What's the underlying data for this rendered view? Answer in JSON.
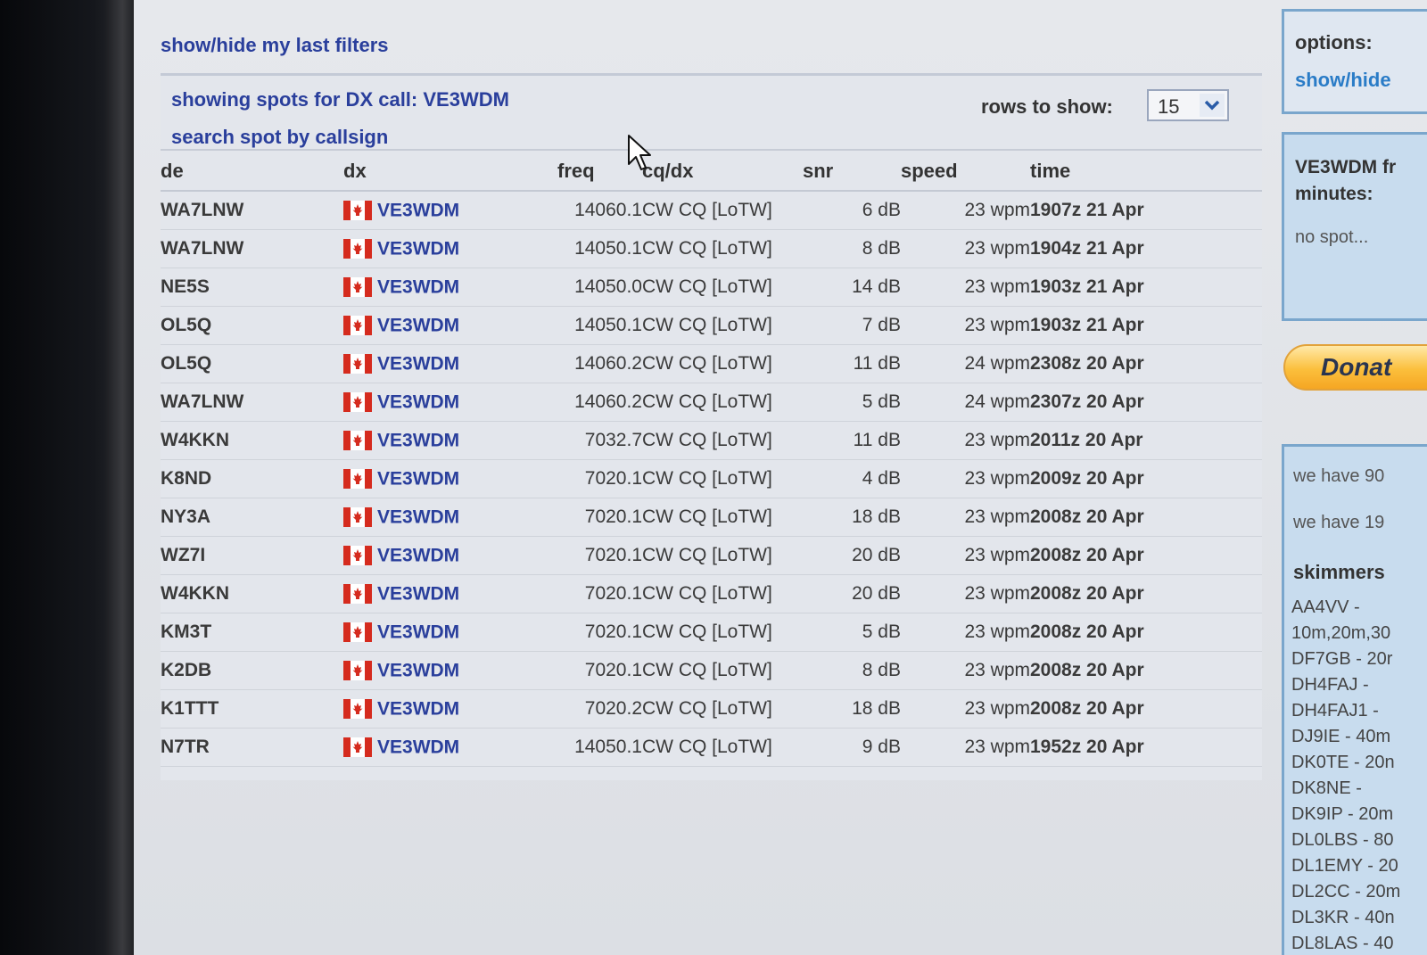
{
  "filters_link": "show/hide my last filters",
  "header": {
    "showing": "showing spots for DX call: VE3WDM",
    "search_link": "search spot by callsign",
    "rows_label": "rows to show:",
    "rows_value": "15"
  },
  "columns": [
    "de",
    "dx",
    "freq",
    "cq/dx",
    "snr",
    "speed",
    "time"
  ],
  "rows": [
    {
      "de": "WA7LNW",
      "dx": "VE3WDM",
      "freq": "14060.1",
      "cq": "CW CQ [LoTW]",
      "snr": "6 dB",
      "speed": "23 wpm",
      "time": "1907z 21 Apr"
    },
    {
      "de": "WA7LNW",
      "dx": "VE3WDM",
      "freq": "14050.1",
      "cq": "CW CQ [LoTW]",
      "snr": "8 dB",
      "speed": "23 wpm",
      "time": "1904z 21 Apr"
    },
    {
      "de": "NE5S",
      "dx": "VE3WDM",
      "freq": "14050.0",
      "cq": "CW CQ [LoTW]",
      "snr": "14 dB",
      "speed": "23 wpm",
      "time": "1903z 21 Apr"
    },
    {
      "de": "OL5Q",
      "dx": "VE3WDM",
      "freq": "14050.1",
      "cq": "CW CQ [LoTW]",
      "snr": "7 dB",
      "speed": "23 wpm",
      "time": "1903z 21 Apr"
    },
    {
      "de": "OL5Q",
      "dx": "VE3WDM",
      "freq": "14060.2",
      "cq": "CW CQ [LoTW]",
      "snr": "11 dB",
      "speed": "24 wpm",
      "time": "2308z 20 Apr"
    },
    {
      "de": "WA7LNW",
      "dx": "VE3WDM",
      "freq": "14060.2",
      "cq": "CW CQ [LoTW]",
      "snr": "5 dB",
      "speed": "24 wpm",
      "time": "2307z 20 Apr"
    },
    {
      "de": "W4KKN",
      "dx": "VE3WDM",
      "freq": "7032.7",
      "cq": "CW CQ [LoTW]",
      "snr": "11 dB",
      "speed": "23 wpm",
      "time": "2011z 20 Apr"
    },
    {
      "de": "K8ND",
      "dx": "VE3WDM",
      "freq": "7020.1",
      "cq": "CW CQ [LoTW]",
      "snr": "4 dB",
      "speed": "23 wpm",
      "time": "2009z 20 Apr"
    },
    {
      "de": "NY3A",
      "dx": "VE3WDM",
      "freq": "7020.1",
      "cq": "CW CQ [LoTW]",
      "snr": "18 dB",
      "speed": "23 wpm",
      "time": "2008z 20 Apr"
    },
    {
      "de": "WZ7I",
      "dx": "VE3WDM",
      "freq": "7020.1",
      "cq": "CW CQ [LoTW]",
      "snr": "20 dB",
      "speed": "23 wpm",
      "time": "2008z 20 Apr"
    },
    {
      "de": "W4KKN",
      "dx": "VE3WDM",
      "freq": "7020.1",
      "cq": "CW CQ [LoTW]",
      "snr": "20 dB",
      "speed": "23 wpm",
      "time": "2008z 20 Apr"
    },
    {
      "de": "KM3T",
      "dx": "VE3WDM",
      "freq": "7020.1",
      "cq": "CW CQ [LoTW]",
      "snr": "5 dB",
      "speed": "23 wpm",
      "time": "2008z 20 Apr"
    },
    {
      "de": "K2DB",
      "dx": "VE3WDM",
      "freq": "7020.1",
      "cq": "CW CQ [LoTW]",
      "snr": "8 dB",
      "speed": "23 wpm",
      "time": "2008z 20 Apr"
    },
    {
      "de": "K1TTT",
      "dx": "VE3WDM",
      "freq": "7020.2",
      "cq": "CW CQ [LoTW]",
      "snr": "18 dB",
      "speed": "23 wpm",
      "time": "2008z 20 Apr"
    },
    {
      "de": "N7TR",
      "dx": "VE3WDM",
      "freq": "14050.1",
      "cq": "CW CQ [LoTW]",
      "snr": "9 dB",
      "speed": "23 wpm",
      "time": "1952z 20 Apr"
    }
  ],
  "sidebar": {
    "options_title": "options:",
    "options_link": "show/hide",
    "spot_title_1": "VE3WDM fr",
    "spot_title_2": "minutes:",
    "spot_none": "no spot...",
    "donate_label": "Donat",
    "stat1": "we have 90",
    "stat2": "we have 19",
    "skimmers_title": "skimmers",
    "skimmers": [
      "AA4VV -",
      "10m,20m,30",
      "DF7GB - 20r",
      "DH4FAJ -",
      "DH4FAJ1 -",
      "DJ9IE - 40m",
      "DK0TE - 20n",
      "DK8NE -",
      "DK9IP - 20m",
      "DL0LBS - 80",
      "DL1EMY - 20",
      "DL2CC - 20m",
      "DL3KR - 40n",
      "DL8LAS - 40"
    ]
  },
  "colors": {
    "link": "#2a3f9c",
    "accent": "#2a7cc7",
    "panel_border": "#7aa6cc",
    "donate": "#fbbf3c"
  },
  "icons": {
    "flag": "canada-flag-icon",
    "select_arrow": "chevron-down-icon",
    "cursor": "mouse-pointer-icon"
  }
}
